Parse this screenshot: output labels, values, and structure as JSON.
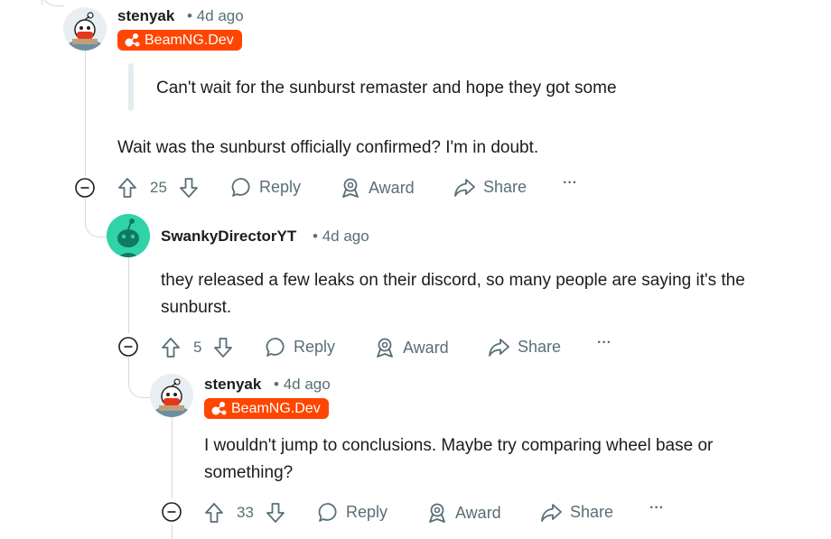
{
  "comments": [
    {
      "username": "stenyak",
      "time": "4d ago",
      "flair": "BeamNG.Dev",
      "quote": "Can't wait for the sunburst remaster and hope they got some",
      "body": "Wait was the sunburst officially confirmed? I'm in doubt.",
      "votes": "25",
      "reply_label": "Reply",
      "award_label": "Award",
      "share_label": "Share",
      "more_label": "···"
    },
    {
      "username": "SwankyDirectorYT",
      "time": "4d ago",
      "body": "they released a few leaks on their discord, so many people are saying it's the sunburst.",
      "votes": "5",
      "reply_label": "Reply",
      "award_label": "Award",
      "share_label": "Share",
      "more_label": "···"
    },
    {
      "username": "stenyak",
      "time": "4d ago",
      "flair": "BeamNG.Dev",
      "body": "I wouldn't jump to conclusions. Maybe try comparing wheel base or something?",
      "votes": "33",
      "reply_label": "Reply",
      "award_label": "Award",
      "share_label": "Share",
      "more_label": "···"
    }
  ],
  "separator": "•",
  "colors": {
    "flair_bg": "#ff4500",
    "meta_text": "#576f76",
    "thread_line": "#d4d8da",
    "avatar_teal": "#2fd3a7"
  },
  "icons": [
    "upvote-icon",
    "downvote-icon",
    "reply-icon",
    "award-icon",
    "share-icon",
    "collapse-icon",
    "flair-icon"
  ]
}
